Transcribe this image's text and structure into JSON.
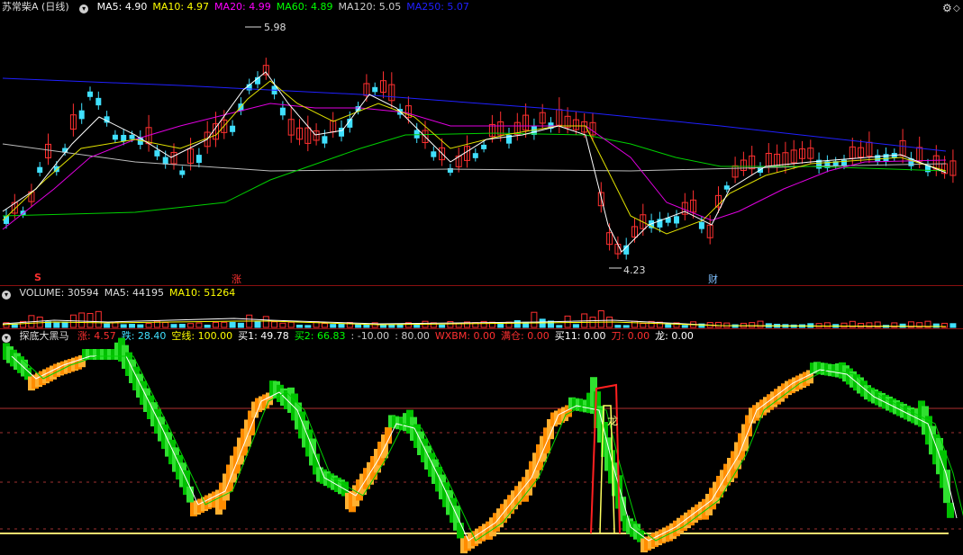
{
  "price_panel": {
    "title": "苏常柴A (日线)",
    "indicators": [
      {
        "label": "MA5: 4.90",
        "color": "#ffffff"
      },
      {
        "label": "MA10: 4.97",
        "color": "#ffff00"
      },
      {
        "label": "MA20: 4.99",
        "color": "#ff00ff"
      },
      {
        "label": "MA60: 4.89",
        "color": "#00ff00"
      },
      {
        "label": "MA120: 5.05",
        "color": "#cccccc"
      },
      {
        "label": "MA250: 5.07",
        "color": "#2020ff"
      }
    ],
    "high_label": "5.98",
    "low_label": "4.23",
    "markers": [
      {
        "text": "S",
        "color": "#ff3030"
      },
      {
        "text": "涨",
        "color": "#ff3030"
      },
      {
        "text": "财",
        "color": "#80c0ff"
      }
    ],
    "corner_icons": [
      "⚙",
      "◇"
    ]
  },
  "volume_panel": {
    "items": [
      {
        "label": "VOLUME: 30594",
        "color": "#dddddd"
      },
      {
        "label": "MA5: 44195",
        "color": "#dddddd"
      },
      {
        "label": "MA10: 51264",
        "color": "#ffff00"
      }
    ]
  },
  "indicator_panel": {
    "title": "探底大黑马",
    "items": [
      {
        "label": "涨: 4.57",
        "color": "#ff3030"
      },
      {
        "label": "跌: 28.40",
        "color": "#40e0ff"
      },
      {
        "label": "空线: 100.00",
        "color": "#ffff00"
      },
      {
        "label": "买1: 49.78",
        "color": "#ffffff"
      },
      {
        "label": "买2: 66.83",
        "color": "#00ff00"
      },
      {
        "label": ": -10.00",
        "color": "#cccccc"
      },
      {
        "label": ": 80.00",
        "color": "#cccccc"
      },
      {
        "label": "WXBM: 0.00",
        "color": "#ff3030"
      },
      {
        "label": "满仓: 0.00",
        "color": "#ff3030"
      },
      {
        "label": "买11: 0.00",
        "color": "#ffffff"
      },
      {
        "label": "刀: 0.00",
        "color": "#ff3030"
      },
      {
        "label": "龙: 0.00",
        "color": "#ffffff"
      }
    ],
    "signal_label": "龙"
  }
}
